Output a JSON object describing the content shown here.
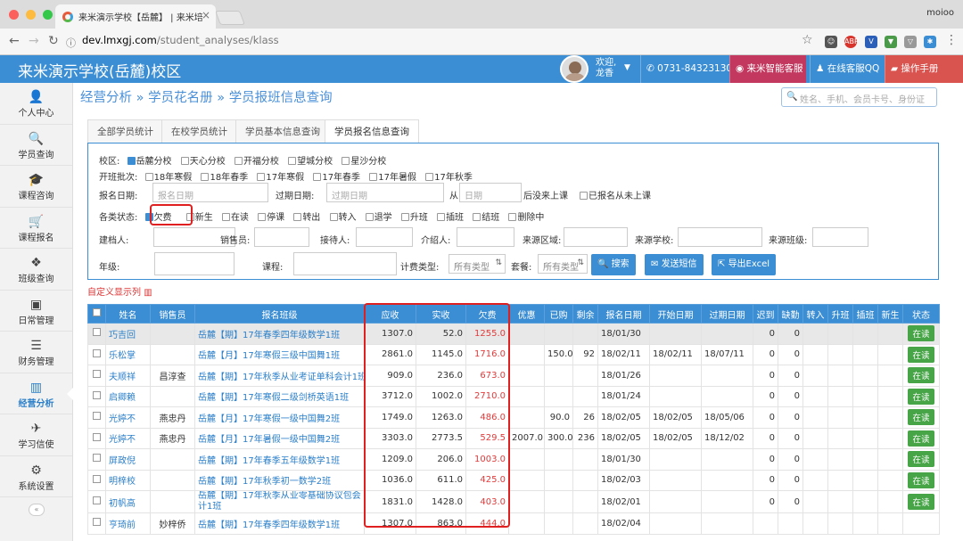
{
  "browser": {
    "tab_title": "来米演示学校【岳麓】 | 来米培",
    "url_domain": "dev.lmxgj.com",
    "url_path": "/student_analyses/klass",
    "profile": "moioo",
    "ext_abp": "ABP",
    "colors": {
      "close": "#fc605c",
      "minimize": "#fdbc40",
      "maximize": "#34c84a"
    }
  },
  "header": {
    "title": "来米演示学校(岳麓)校区",
    "welcome_line1": "欢迎,",
    "welcome_line2": "龙香",
    "phone": "0731-84323130",
    "service": "来米智能客服",
    "qq": "在线客服QQ",
    "manual": "操作手册"
  },
  "sidebar": {
    "items": [
      {
        "label": "个人中心",
        "icon": "user-icon"
      },
      {
        "label": "学员查询",
        "icon": "search-icon"
      },
      {
        "label": "课程咨询",
        "icon": "graduation-cap-icon"
      },
      {
        "label": "课程报名",
        "icon": "cart-icon"
      },
      {
        "label": "班级查询",
        "icon": "cubes-icon"
      },
      {
        "label": "日常管理",
        "icon": "clipboard-icon"
      },
      {
        "label": "财务管理",
        "icon": "menu-icon"
      },
      {
        "label": "经营分析",
        "icon": "bar-chart-icon"
      },
      {
        "label": "学习信使",
        "icon": "bird-icon"
      },
      {
        "label": "系统设置",
        "icon": "gears-icon"
      }
    ],
    "active_index": 7
  },
  "breadcrumb": {
    "part1": "经营分析",
    "part2": "学员花名册",
    "part3": "学员报班信息查询",
    "sep": "»"
  },
  "search": {
    "placeholder": "姓名、手机、会员卡号、身份证"
  },
  "tabs": [
    "全部学员统计",
    "在校学员统计",
    "学员基本信息查询",
    "学员报名信息查询"
  ],
  "filter": {
    "campus_label": "校区:",
    "campus": [
      "岳麓分校",
      "天心分校",
      "开福分校",
      "望城分校",
      "星沙分校"
    ],
    "batch_label": "开班批次:",
    "batch": [
      "18年寒假",
      "18年春季",
      "17年寒假",
      "17年春季",
      "17年暑假",
      "17年秋季"
    ],
    "enroll_date_label": "报名日期:",
    "enroll_date_ph": "报名日期",
    "expire_date_label": "过期日期:",
    "expire_date_ph": "过期日期",
    "from_label": "从",
    "date_ph": "日期",
    "after_label": "后没来上课",
    "never_label": "已报名从未上课",
    "status_label": "各类状态:",
    "statuses": [
      "欠费",
      "新生",
      "在读",
      "停课",
      "转出",
      "转入",
      "退学",
      "升班",
      "插班",
      "结班",
      "删除中"
    ],
    "creator_label": "建档人:",
    "seller_label": "销售员:",
    "receiver_label": "接待人:",
    "referrer_label": "介绍人:",
    "source_region_label": "来源区域:",
    "source_school_label": "来源学校:",
    "source_class_label": "来源班级:",
    "grade_label": "年级:",
    "course_label": "课程:",
    "fee_type_label": "计费类型:",
    "fee_type_value": "所有类型",
    "package_label": "套餐:",
    "package_value": "所有类型",
    "btn_search": "搜索",
    "btn_sms": "发送短信",
    "btn_excel": "导出Excel"
  },
  "custom_cols": "自定义显示列",
  "table": {
    "headers": [
      "姓名",
      "销售员",
      "报名班级",
      "应收",
      "实收",
      "欠费",
      "优惠",
      "已购",
      "剩余",
      "报名日期",
      "开始日期",
      "过期日期",
      "迟到",
      "缺勤",
      "转入",
      "升班",
      "插班",
      "新生",
      "状态"
    ],
    "rows": [
      {
        "name": "巧吉回",
        "seller": "",
        "klass": "岳麓【期】17年春季四年级数学1班",
        "due": "1307.0",
        "paid": "52.0",
        "owe": "1255.0",
        "discount": "",
        "bought": "",
        "remain": "",
        "enroll": "18/01/30",
        "start": "",
        "expire": "",
        "late": "0",
        "absent": "0",
        "status": "在读"
      },
      {
        "name": "乐松掌",
        "seller": "",
        "klass": "岳麓【月】17年寒假三级中国舞1班",
        "due": "2861.0",
        "paid": "1145.0",
        "owe": "1716.0",
        "discount": "",
        "bought": "150.0",
        "remain": "92",
        "enroll": "18/02/11",
        "start": "18/02/11",
        "expire": "18/07/11",
        "late": "0",
        "absent": "0",
        "status": "在读"
      },
      {
        "name": "夫顺祥",
        "seller": "昌淳查",
        "klass": "岳麓【期】17年秋季从业考证单科会计1班",
        "due": "909.0",
        "paid": "236.0",
        "owe": "673.0",
        "discount": "",
        "bought": "",
        "remain": "",
        "enroll": "18/01/26",
        "start": "",
        "expire": "",
        "late": "0",
        "absent": "0",
        "status": "在读"
      },
      {
        "name": "启卿赖",
        "seller": "",
        "klass": "岳麓【期】17年寒假二级剑桥英语1班",
        "due": "3712.0",
        "paid": "1002.0",
        "owe": "2710.0",
        "discount": "",
        "bought": "",
        "remain": "",
        "enroll": "18/01/24",
        "start": "",
        "expire": "",
        "late": "0",
        "absent": "0",
        "status": "在读"
      },
      {
        "name": "光婷不",
        "seller": "燕忠丹",
        "klass": "岳麓【月】17年寒假一级中国舞2班",
        "due": "1749.0",
        "paid": "1263.0",
        "owe": "486.0",
        "discount": "",
        "bought": "90.0",
        "remain": "26",
        "enroll": "18/02/05",
        "start": "18/02/05",
        "expire": "18/05/06",
        "late": "0",
        "absent": "0",
        "status": "在读"
      },
      {
        "name": "光婷不",
        "seller": "燕忠丹",
        "klass": "岳麓【月】17年暑假一级中国舞2班",
        "due": "3303.0",
        "paid": "2773.5",
        "owe": "529.5",
        "discount": "2007.0",
        "bought": "300.0",
        "remain": "236",
        "enroll": "18/02/05",
        "start": "18/02/05",
        "expire": "18/12/02",
        "late": "0",
        "absent": "0",
        "status": "在读"
      },
      {
        "name": "屏政倪",
        "seller": "",
        "klass": "岳麓【期】17年春季五年级数学1班",
        "due": "1209.0",
        "paid": "206.0",
        "owe": "1003.0",
        "discount": "",
        "bought": "",
        "remain": "",
        "enroll": "18/01/30",
        "start": "",
        "expire": "",
        "late": "0",
        "absent": "0",
        "status": "在读"
      },
      {
        "name": "明梓校",
        "seller": "",
        "klass": "岳麓【期】17年秋季初一数学2班",
        "due": "1036.0",
        "paid": "611.0",
        "owe": "425.0",
        "discount": "",
        "bought": "",
        "remain": "",
        "enroll": "18/02/03",
        "start": "",
        "expire": "",
        "late": "0",
        "absent": "0",
        "status": "在读"
      },
      {
        "name": "初帆高",
        "seller": "",
        "klass": "岳麓【期】17年秋季从业零基础协议包会计1班",
        "due": "1831.0",
        "paid": "1428.0",
        "owe": "403.0",
        "discount": "",
        "bought": "",
        "remain": "",
        "enroll": "18/02/01",
        "start": "",
        "expire": "",
        "late": "0",
        "absent": "0",
        "status": "在读"
      },
      {
        "name": "亨琦前",
        "seller": "妙梓侨",
        "klass": "岳麓【期】17年春季四年级数学1班",
        "due": "1307.0",
        "paid": "863.0",
        "owe": "444.0",
        "discount": "",
        "bought": "",
        "remain": "",
        "enroll": "18/02/04",
        "start": "",
        "expire": "",
        "late": "",
        "absent": "",
        "status": ""
      }
    ]
  }
}
